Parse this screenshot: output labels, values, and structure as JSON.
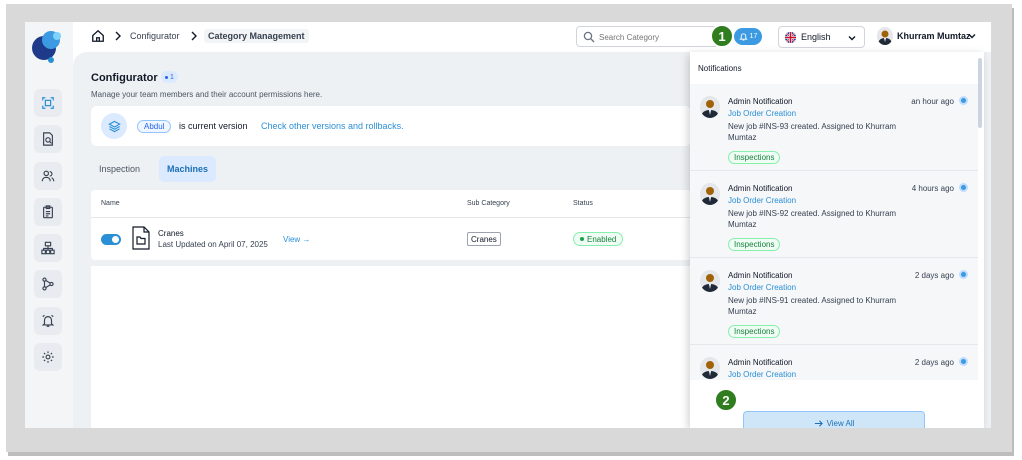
{
  "breadcrumb": {
    "items": [
      "Configurator",
      "Category Management"
    ]
  },
  "search": {
    "placeholder": "Search Category"
  },
  "notifications_badge": {
    "count": "17"
  },
  "language": {
    "selected": "English"
  },
  "user": {
    "name": "Khurram Mumtaz"
  },
  "page": {
    "title": "Configurator",
    "count": "1",
    "subtitle": "Manage your team members and their account permissions here."
  },
  "version": {
    "chip": "Abdul",
    "text": "is current version",
    "link": "Check other versions and rollbacks."
  },
  "tabs": [
    {
      "label": "Inspection"
    },
    {
      "label": "Machines"
    }
  ],
  "table": {
    "columns": {
      "name": "Name",
      "sub_category": "Sub Category",
      "status": "Status"
    },
    "rows": [
      {
        "name": "Cranes",
        "updated": "Last Updated on April 07, 2025",
        "view": "View",
        "sub_category": "Cranes",
        "status": "Enabled"
      }
    ]
  },
  "notifications": {
    "title": "Notifications",
    "items": [
      {
        "title": "Admin Notification",
        "time": "an hour ago",
        "type": "Job Order Creation",
        "message": "New job #INS-93 created. Assigned to Khurram Mumtaz",
        "tag": "Inspections"
      },
      {
        "title": "Admin Notification",
        "time": "4 hours ago",
        "type": "Job Order Creation",
        "message": "New job #INS-92 created. Assigned to Khurram Mumtaz",
        "tag": "Inspections"
      },
      {
        "title": "Admin Notification",
        "time": "2 days ago",
        "type": "Job Order Creation",
        "message": "New job #INS-91 created. Assigned to Khurram Mumtaz",
        "tag": "Inspections"
      },
      {
        "title": "Admin Notification",
        "time": "2 days ago",
        "type": "Job Order Creation",
        "message": "",
        "tag": ""
      }
    ],
    "view_all": "View All"
  },
  "markers": [
    "1",
    "2"
  ],
  "colors": {
    "accent": "#2b8fd6",
    "success": "#15803d",
    "marker": "#2f7d1f"
  }
}
